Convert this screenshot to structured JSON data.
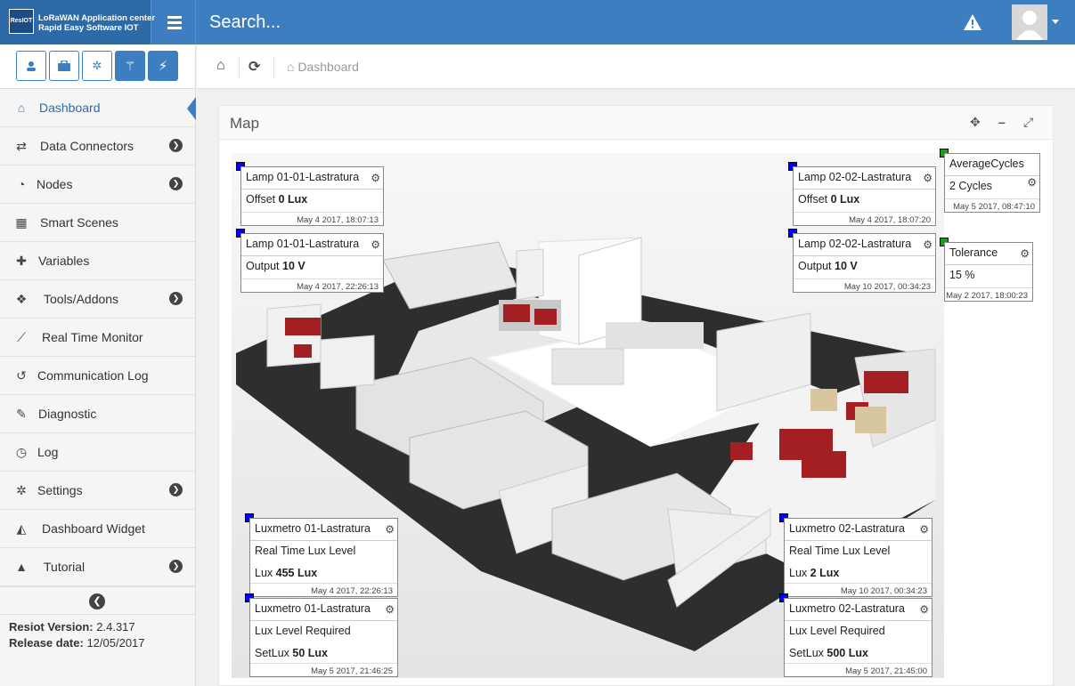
{
  "brand": {
    "logo": "ResIOT",
    "line1": "LoRaWAN Application center",
    "line2": "Rapid Easy Software IOT"
  },
  "search": {
    "placeholder": "Search..."
  },
  "sidebar": {
    "items": [
      {
        "label": "Dashboard",
        "icon": "home-icon"
      },
      {
        "label": "Data Connectors",
        "icon": "exchange-icon"
      },
      {
        "label": "Nodes",
        "icon": "rss-icon"
      },
      {
        "label": "Smart Scenes",
        "icon": "film-icon"
      },
      {
        "label": "Variables",
        "icon": "puzzle-icon"
      },
      {
        "label": "Tools/Addons",
        "icon": "cubes-icon"
      },
      {
        "label": "Real Time Monitor",
        "icon": "line-chart-icon"
      },
      {
        "label": "Communication Log",
        "icon": "history-icon"
      },
      {
        "label": "Diagnostic",
        "icon": "wrench-icon"
      },
      {
        "label": "Log",
        "icon": "clock-icon"
      },
      {
        "label": "Settings",
        "icon": "gear-icon"
      },
      {
        "label": "Dashboard Widget",
        "icon": "area-chart-icon"
      },
      {
        "label": "Tutorial",
        "icon": "graduation-cap-icon"
      }
    ],
    "version_label": "Resiot Version:",
    "version": "2.4.317",
    "release_label": "Release date:",
    "release": "12/05/2017"
  },
  "breadcrumb": {
    "current": "Dashboard"
  },
  "panel": {
    "title": "Map"
  },
  "widgets": {
    "w1": {
      "title": "Lamp 01-01-Lastratura",
      "label": "Offset",
      "value": "0 Lux",
      "ts": "May 4 2017, 18:07:13"
    },
    "w2": {
      "title": "Lamp 01-01-Lastratura",
      "label": "Output",
      "value": "10 V",
      "ts": "May 4 2017, 22:26:13"
    },
    "w3": {
      "title": "Lamp 02-02-Lastratura",
      "label": "Offset",
      "value": "0 Lux",
      "ts": "May 4 2017, 18:07:20"
    },
    "w4": {
      "title": "Lamp 02-02-Lastratura",
      "label": "Output",
      "value": "10 V",
      "ts": "May 10 2017, 00:34:23"
    },
    "w5": {
      "title": "AverageCycles",
      "value": "2 Cycles",
      "ts": "May 5 2017, 08:47:10"
    },
    "w6": {
      "title": "Tolerance",
      "value": "15 %",
      "ts": "May 2 2017, 18:00:23"
    },
    "w7": {
      "title": "Luxmetro 01-Lastratura",
      "desc": "Real Time Lux Level",
      "label": "Lux",
      "value": "455 Lux",
      "ts": "May 4 2017, 22:26:13"
    },
    "w8": {
      "title": "Luxmetro 01-Lastratura",
      "desc": "Lux Level Required",
      "label": "SetLux",
      "value": "50 Lux",
      "ts": "May 5 2017, 21:46:25"
    },
    "w9": {
      "title": "Luxmetro 02-Lastratura",
      "desc": "Real Time Lux Level",
      "label": "Lux",
      "value": "2 Lux",
      "ts": "May 10 2017, 00:34:23"
    },
    "w10": {
      "title": "Luxmetro 02-Lastratura",
      "desc": "Lux Level Required",
      "label": "SetLux",
      "value": "500 Lux",
      "ts": "May 5 2017, 21:45:00"
    }
  },
  "colors": {
    "header": "#3c7ec0",
    "marker_lamp": "#0000ff",
    "marker_var": "#1c9a1c"
  }
}
